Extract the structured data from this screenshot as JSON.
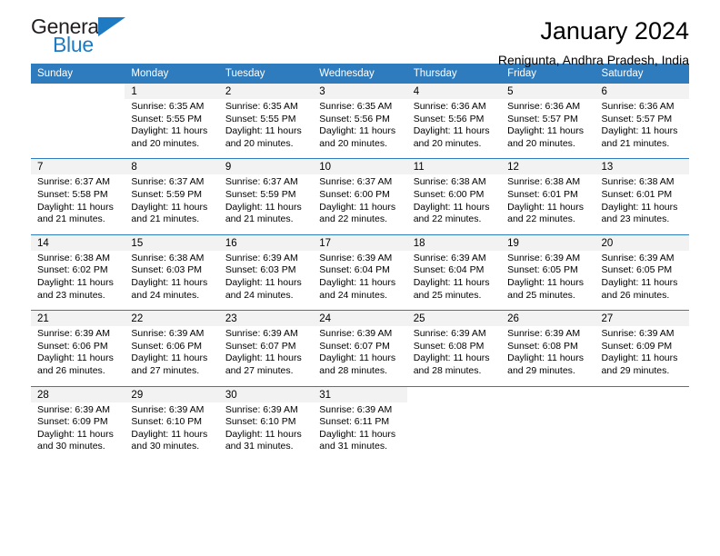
{
  "brand": {
    "name_part1": "General",
    "name_part2": "Blue",
    "triangle_color": "#1f7ac4"
  },
  "header": {
    "month_title": "January 2024",
    "location": "Renigunta, Andhra Pradesh, India"
  },
  "theme": {
    "header_blue": "#2e7cbe",
    "daynum_bg": "#f2f2f2",
    "text": "#000000"
  },
  "weekdays": [
    "Sunday",
    "Monday",
    "Tuesday",
    "Wednesday",
    "Thursday",
    "Friday",
    "Saturday"
  ],
  "weeks": [
    {
      "days": [
        {
          "num": "",
          "sunrise": "",
          "sunset": "",
          "daylight1": "",
          "daylight2": ""
        },
        {
          "num": "1",
          "sunrise": "Sunrise: 6:35 AM",
          "sunset": "Sunset: 5:55 PM",
          "daylight1": "Daylight: 11 hours",
          "daylight2": "and 20 minutes."
        },
        {
          "num": "2",
          "sunrise": "Sunrise: 6:35 AM",
          "sunset": "Sunset: 5:55 PM",
          "daylight1": "Daylight: 11 hours",
          "daylight2": "and 20 minutes."
        },
        {
          "num": "3",
          "sunrise": "Sunrise: 6:35 AM",
          "sunset": "Sunset: 5:56 PM",
          "daylight1": "Daylight: 11 hours",
          "daylight2": "and 20 minutes."
        },
        {
          "num": "4",
          "sunrise": "Sunrise: 6:36 AM",
          "sunset": "Sunset: 5:56 PM",
          "daylight1": "Daylight: 11 hours",
          "daylight2": "and 20 minutes."
        },
        {
          "num": "5",
          "sunrise": "Sunrise: 6:36 AM",
          "sunset": "Sunset: 5:57 PM",
          "daylight1": "Daylight: 11 hours",
          "daylight2": "and 20 minutes."
        },
        {
          "num": "6",
          "sunrise": "Sunrise: 6:36 AM",
          "sunset": "Sunset: 5:57 PM",
          "daylight1": "Daylight: 11 hours",
          "daylight2": "and 21 minutes."
        }
      ]
    },
    {
      "days": [
        {
          "num": "7",
          "sunrise": "Sunrise: 6:37 AM",
          "sunset": "Sunset: 5:58 PM",
          "daylight1": "Daylight: 11 hours",
          "daylight2": "and 21 minutes."
        },
        {
          "num": "8",
          "sunrise": "Sunrise: 6:37 AM",
          "sunset": "Sunset: 5:59 PM",
          "daylight1": "Daylight: 11 hours",
          "daylight2": "and 21 minutes."
        },
        {
          "num": "9",
          "sunrise": "Sunrise: 6:37 AM",
          "sunset": "Sunset: 5:59 PM",
          "daylight1": "Daylight: 11 hours",
          "daylight2": "and 21 minutes."
        },
        {
          "num": "10",
          "sunrise": "Sunrise: 6:37 AM",
          "sunset": "Sunset: 6:00 PM",
          "daylight1": "Daylight: 11 hours",
          "daylight2": "and 22 minutes."
        },
        {
          "num": "11",
          "sunrise": "Sunrise: 6:38 AM",
          "sunset": "Sunset: 6:00 PM",
          "daylight1": "Daylight: 11 hours",
          "daylight2": "and 22 minutes."
        },
        {
          "num": "12",
          "sunrise": "Sunrise: 6:38 AM",
          "sunset": "Sunset: 6:01 PM",
          "daylight1": "Daylight: 11 hours",
          "daylight2": "and 22 minutes."
        },
        {
          "num": "13",
          "sunrise": "Sunrise: 6:38 AM",
          "sunset": "Sunset: 6:01 PM",
          "daylight1": "Daylight: 11 hours",
          "daylight2": "and 23 minutes."
        }
      ]
    },
    {
      "days": [
        {
          "num": "14",
          "sunrise": "Sunrise: 6:38 AM",
          "sunset": "Sunset: 6:02 PM",
          "daylight1": "Daylight: 11 hours",
          "daylight2": "and 23 minutes."
        },
        {
          "num": "15",
          "sunrise": "Sunrise: 6:38 AM",
          "sunset": "Sunset: 6:03 PM",
          "daylight1": "Daylight: 11 hours",
          "daylight2": "and 24 minutes."
        },
        {
          "num": "16",
          "sunrise": "Sunrise: 6:39 AM",
          "sunset": "Sunset: 6:03 PM",
          "daylight1": "Daylight: 11 hours",
          "daylight2": "and 24 minutes."
        },
        {
          "num": "17",
          "sunrise": "Sunrise: 6:39 AM",
          "sunset": "Sunset: 6:04 PM",
          "daylight1": "Daylight: 11 hours",
          "daylight2": "and 24 minutes."
        },
        {
          "num": "18",
          "sunrise": "Sunrise: 6:39 AM",
          "sunset": "Sunset: 6:04 PM",
          "daylight1": "Daylight: 11 hours",
          "daylight2": "and 25 minutes."
        },
        {
          "num": "19",
          "sunrise": "Sunrise: 6:39 AM",
          "sunset": "Sunset: 6:05 PM",
          "daylight1": "Daylight: 11 hours",
          "daylight2": "and 25 minutes."
        },
        {
          "num": "20",
          "sunrise": "Sunrise: 6:39 AM",
          "sunset": "Sunset: 6:05 PM",
          "daylight1": "Daylight: 11 hours",
          "daylight2": "and 26 minutes."
        }
      ]
    },
    {
      "days": [
        {
          "num": "21",
          "sunrise": "Sunrise: 6:39 AM",
          "sunset": "Sunset: 6:06 PM",
          "daylight1": "Daylight: 11 hours",
          "daylight2": "and 26 minutes."
        },
        {
          "num": "22",
          "sunrise": "Sunrise: 6:39 AM",
          "sunset": "Sunset: 6:06 PM",
          "daylight1": "Daylight: 11 hours",
          "daylight2": "and 27 minutes."
        },
        {
          "num": "23",
          "sunrise": "Sunrise: 6:39 AM",
          "sunset": "Sunset: 6:07 PM",
          "daylight1": "Daylight: 11 hours",
          "daylight2": "and 27 minutes."
        },
        {
          "num": "24",
          "sunrise": "Sunrise: 6:39 AM",
          "sunset": "Sunset: 6:07 PM",
          "daylight1": "Daylight: 11 hours",
          "daylight2": "and 28 minutes."
        },
        {
          "num": "25",
          "sunrise": "Sunrise: 6:39 AM",
          "sunset": "Sunset: 6:08 PM",
          "daylight1": "Daylight: 11 hours",
          "daylight2": "and 28 minutes."
        },
        {
          "num": "26",
          "sunrise": "Sunrise: 6:39 AM",
          "sunset": "Sunset: 6:08 PM",
          "daylight1": "Daylight: 11 hours",
          "daylight2": "and 29 minutes."
        },
        {
          "num": "27",
          "sunrise": "Sunrise: 6:39 AM",
          "sunset": "Sunset: 6:09 PM",
          "daylight1": "Daylight: 11 hours",
          "daylight2": "and 29 minutes."
        }
      ]
    },
    {
      "days": [
        {
          "num": "28",
          "sunrise": "Sunrise: 6:39 AM",
          "sunset": "Sunset: 6:09 PM",
          "daylight1": "Daylight: 11 hours",
          "daylight2": "and 30 minutes."
        },
        {
          "num": "29",
          "sunrise": "Sunrise: 6:39 AM",
          "sunset": "Sunset: 6:10 PM",
          "daylight1": "Daylight: 11 hours",
          "daylight2": "and 30 minutes."
        },
        {
          "num": "30",
          "sunrise": "Sunrise: 6:39 AM",
          "sunset": "Sunset: 6:10 PM",
          "daylight1": "Daylight: 11 hours",
          "daylight2": "and 31 minutes."
        },
        {
          "num": "31",
          "sunrise": "Sunrise: 6:39 AM",
          "sunset": "Sunset: 6:11 PM",
          "daylight1": "Daylight: 11 hours",
          "daylight2": "and 31 minutes."
        },
        {
          "num": "",
          "sunrise": "",
          "sunset": "",
          "daylight1": "",
          "daylight2": ""
        },
        {
          "num": "",
          "sunrise": "",
          "sunset": "",
          "daylight1": "",
          "daylight2": ""
        },
        {
          "num": "",
          "sunrise": "",
          "sunset": "",
          "daylight1": "",
          "daylight2": ""
        }
      ]
    }
  ]
}
